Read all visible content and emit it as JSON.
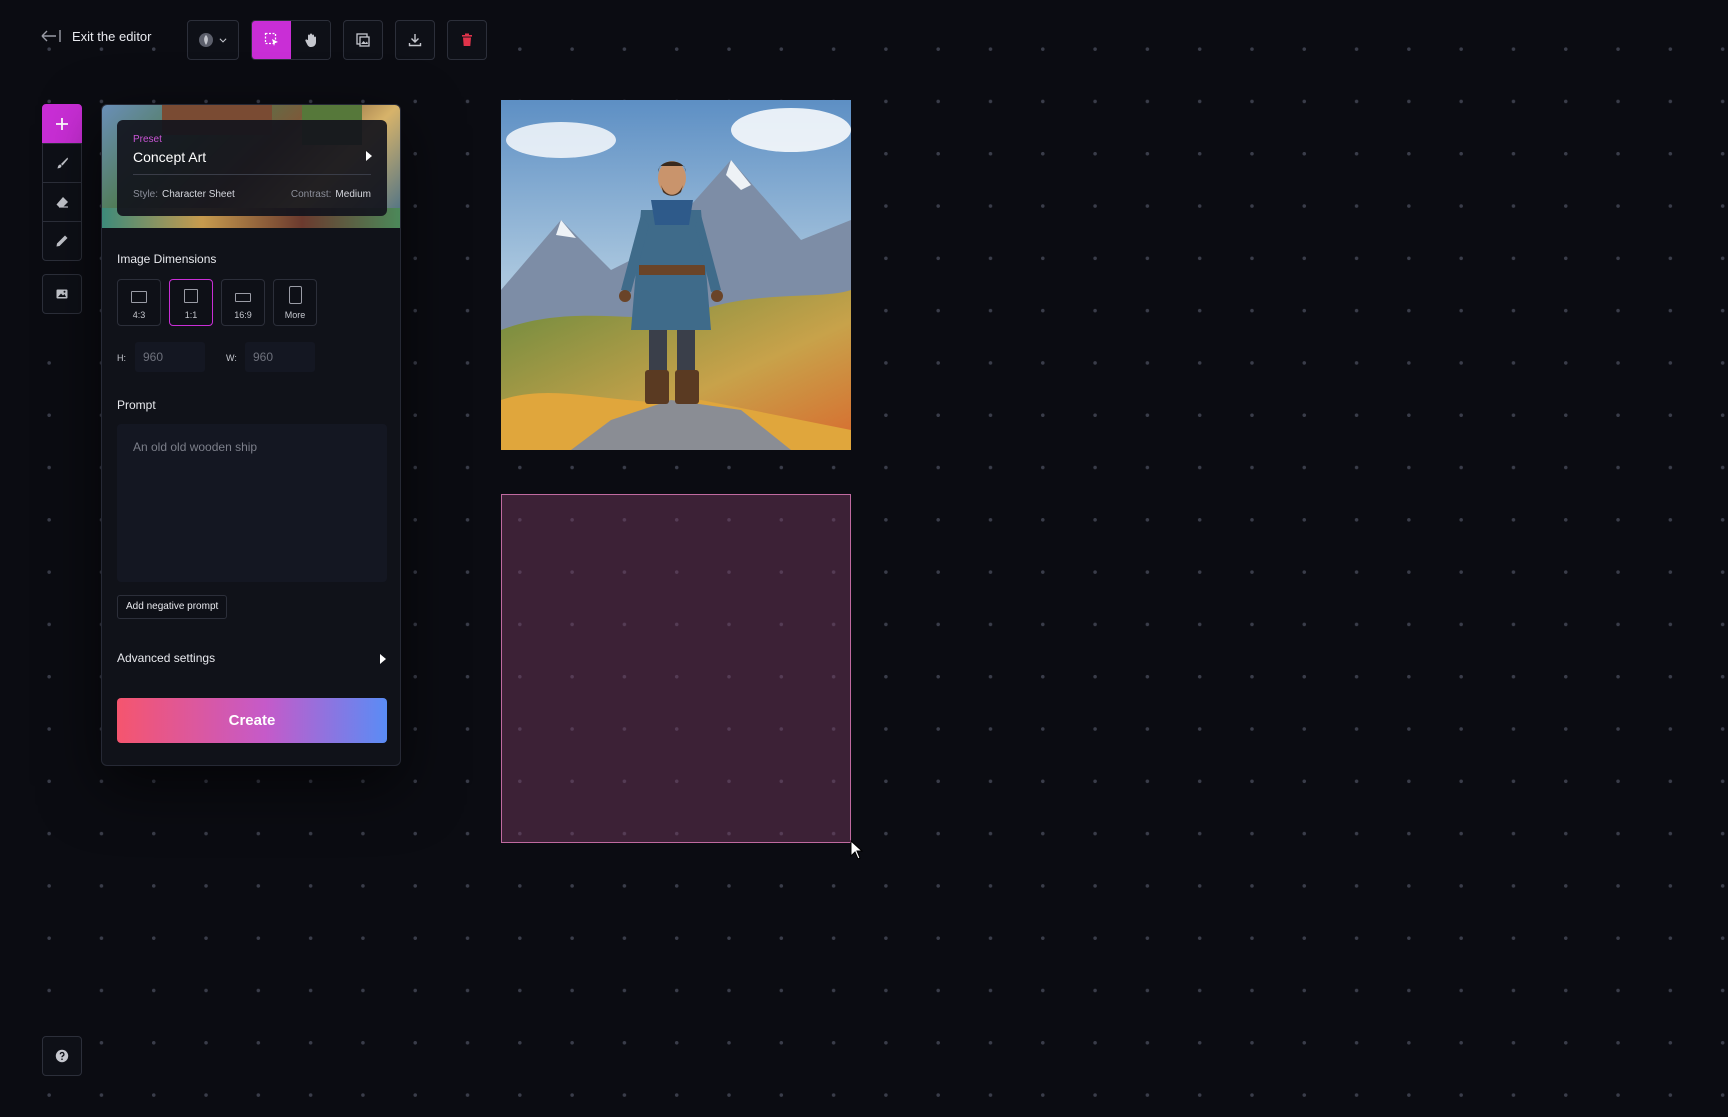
{
  "topbar": {
    "exit_label": "Exit the editor"
  },
  "panel": {
    "preset": {
      "label": "Preset",
      "name": "Concept Art",
      "style_key": "Style:",
      "style_value": "Character Sheet",
      "contrast_key": "Contrast:",
      "contrast_value": "Medium"
    },
    "dimensions_title": "Image Dimensions",
    "ratios": [
      {
        "label": "4:3",
        "selected": false
      },
      {
        "label": "1:1",
        "selected": true
      },
      {
        "label": "16:9",
        "selected": false
      },
      {
        "label": "More",
        "selected": false
      }
    ],
    "height_label": "H:",
    "height_value": "960",
    "width_label": "W:",
    "width_value": "960",
    "prompt_title": "Prompt",
    "prompt_placeholder": "An old old wooden ship",
    "negative_prompt_label": "Add negative prompt",
    "advanced_label": "Advanced settings",
    "create_label": "Create"
  },
  "colors": {
    "accent": "#c92ed6",
    "background": "#0b0c12",
    "delete_icon": "#e0334a"
  },
  "icons": {
    "exit": "arrow-left-bar-icon",
    "model": "model-avatar-icon",
    "select": "select-cursor-icon",
    "pan": "hand-icon",
    "layers": "image-gallery-icon",
    "download": "download-icon",
    "delete": "trash-icon",
    "add": "plus-icon",
    "brush": "brush-icon",
    "eraser": "eraser-icon",
    "pencil": "pencil-icon",
    "image": "image-icon",
    "help": "question-icon"
  }
}
